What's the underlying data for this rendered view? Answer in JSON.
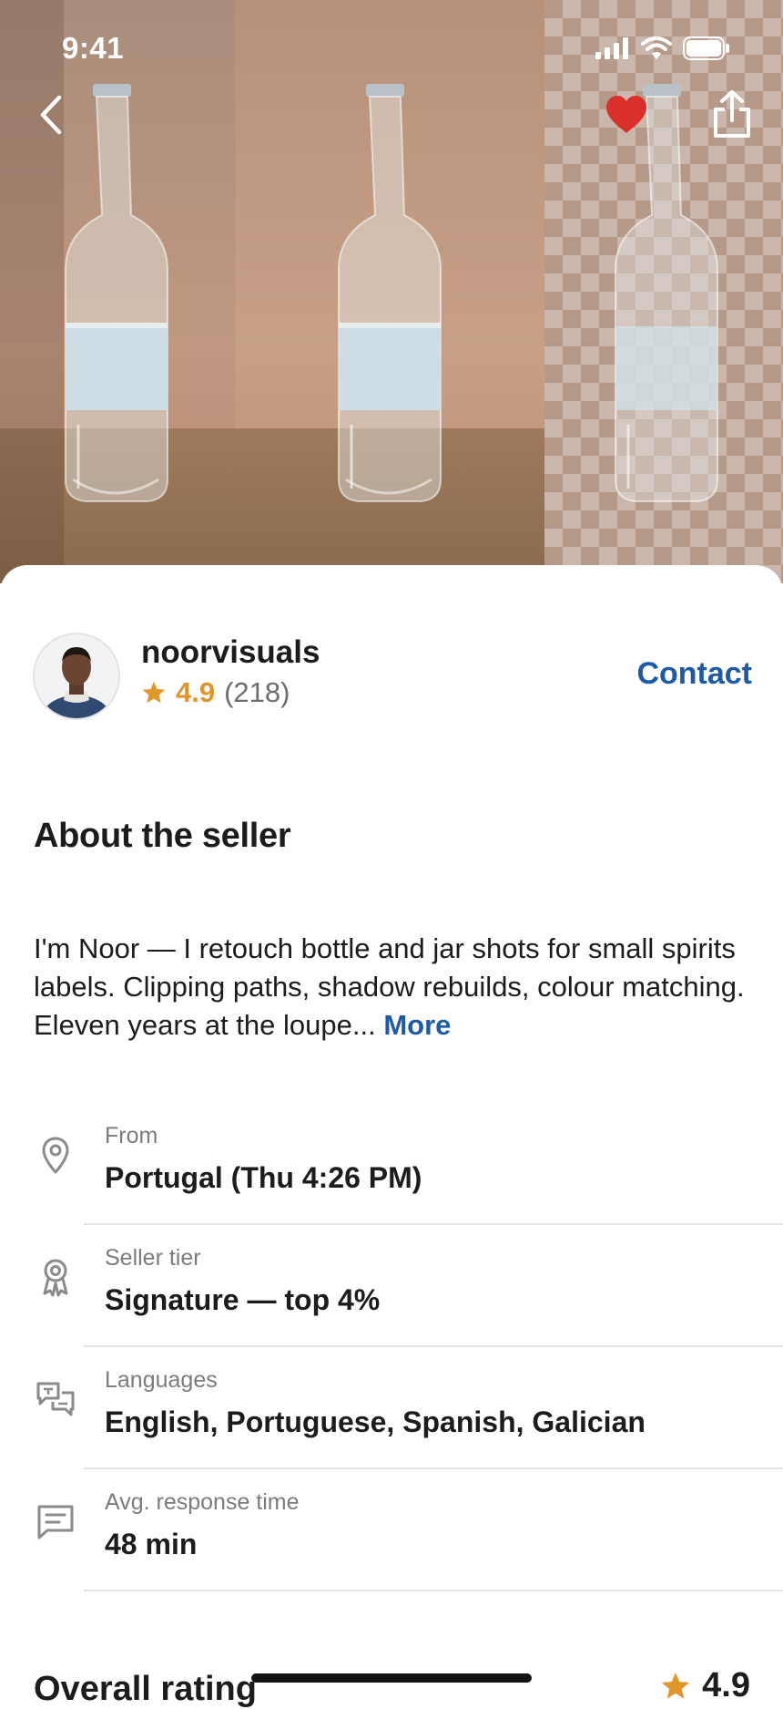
{
  "status_bar": {
    "time": "9:41",
    "icons": [
      "signal-icon",
      "wifi-icon",
      "battery-icon"
    ]
  },
  "hero": {
    "image": "three-glass-bottles-retouch-comparison",
    "buttons": [
      "back-icon",
      "heart-icon",
      "share-icon"
    ],
    "favorited": true
  },
  "seller": {
    "username": "noorvisuals",
    "rating": "4.9",
    "review_count": "(218)",
    "contact_label": "Contact"
  },
  "about": {
    "title": "About the seller",
    "text": "I'm Noor — I retouch bottle and jar shots for small spirits labels. Clipping paths, shadow rebuilds, colour matching. Eleven years at the loupe...",
    "more_label": "More"
  },
  "info": [
    {
      "icon": "location-pin-icon",
      "label": "From",
      "value": "Portugal (Thu 4:26 PM)"
    },
    {
      "icon": "award-ribbon-icon",
      "label": "Seller tier",
      "value": "Signature — top 4%"
    },
    {
      "icon": "translate-chat-icon",
      "label": "Languages",
      "value": "English, Portuguese, Spanish, Galician"
    },
    {
      "icon": "message-icon",
      "label": "Avg. response time",
      "value": "48 min"
    }
  ],
  "overall": {
    "title": "Overall rating",
    "score": "4.9"
  },
  "colors": {
    "accent_link": "#1f5aa6",
    "star": "#e0962b",
    "favorite": "#d9302c"
  }
}
